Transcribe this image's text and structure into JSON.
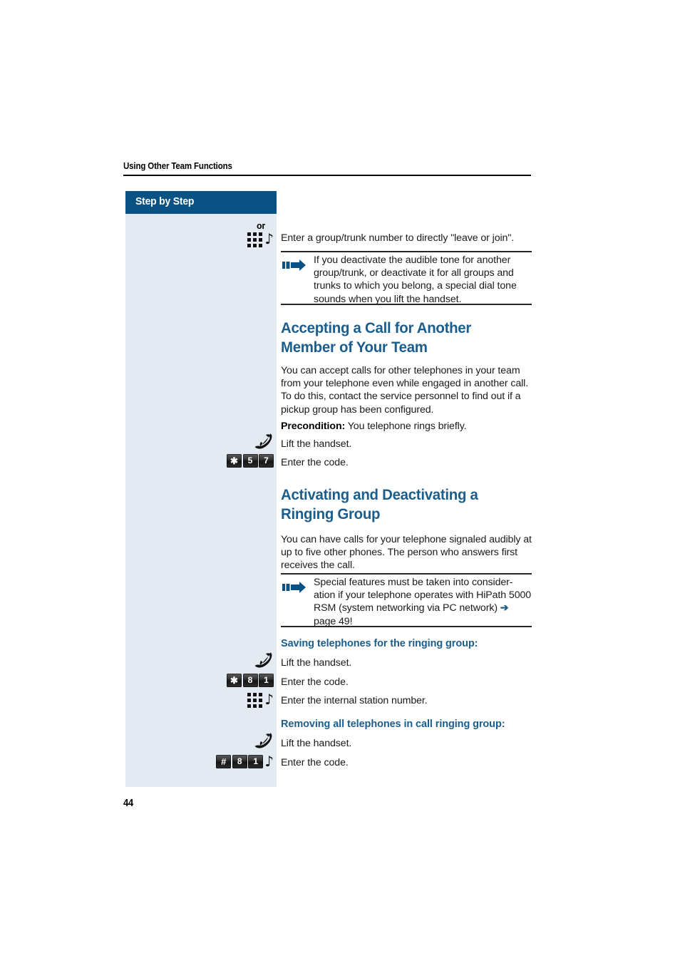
{
  "page": {
    "running_head": "Using Other Team Functions",
    "folio": "44"
  },
  "sidebar": {
    "header_label": "Step by Step",
    "panel_color": "#e3eaf2",
    "header_color": "#0a5284"
  },
  "colors": {
    "heading_blue": "#1b5e8e",
    "arrow_blue": "#1b5e8e",
    "sidebar_header": "#0a5284",
    "sidebar_panel": "#e3eaf2",
    "body_text": "#1a1a1a"
  },
  "blocks": {
    "or_label": "or",
    "keypad_line_1": {
      "icon": "keypad-icon",
      "note_icon": "music-note-icon",
      "text": "Enter a group/trunk number to directly \"leave or join\"."
    },
    "note_1": {
      "icon": "blue-arrow-icon",
      "text": "If you deactivate the audible tone for another group/trunk, or deactivate it for all groups and trunks to which you belong, a special dial tone sounds when you lift the handset."
    },
    "heading_1": "Accepting a Call for Another Member of Your Team",
    "para_1": "You can accept calls for other telephones in your team from your telephone even while engaged in another call. To do this, contact the service personnel to find out if a pickup group has been configured.",
    "precondition_label": "Precondition:",
    "precondition_text": " You telephone rings briefly.",
    "step_lift_1": {
      "icon": "handset-icon",
      "text": "Lift the handset."
    },
    "step_code_1": {
      "keys": [
        "✱",
        "5",
        "7"
      ],
      "text": "Enter the code."
    },
    "heading_2": "Activating and Deactivating a Ringing Group",
    "para_2": "You can have calls for your telephone signaled audibly at up to five other phones. The person who answers first receives the call.",
    "note_2": {
      "icon": "blue-arrow-icon",
      "text_part_1": "Special features must be taken into consider-ation if your telephone operates with HiPath 5000 RSM (system networking via PC network) ",
      "arrow": "➔",
      "text_part_2": " page 49!"
    },
    "subheading_1": "Saving telephones for the ringing group:",
    "step_lift_2": {
      "icon": "handset-icon",
      "text": "Lift the handset."
    },
    "step_code_2": {
      "keys": [
        "✱",
        "8",
        "1"
      ],
      "text": "Enter the code."
    },
    "step_station": {
      "icon": "keypad-icon",
      "note_icon": "music-note-icon",
      "text": "Enter the internal station number."
    },
    "subheading_2": "Removing all telephones in call ringing group:",
    "step_lift_3": {
      "icon": "handset-icon",
      "text": "Lift the handset."
    },
    "step_code_3": {
      "keys": [
        "#",
        "8",
        "1"
      ],
      "note_icon": "music-note-icon",
      "text": "Enter the code."
    }
  }
}
